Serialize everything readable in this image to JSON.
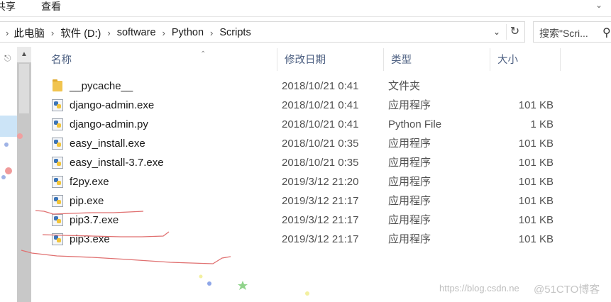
{
  "ribbon": {
    "tabs": [
      "共享",
      "查看"
    ],
    "expand_icon": "chevron-down-icon"
  },
  "address": {
    "crumbs": [
      "此电脑",
      "软件 (D:)",
      "software",
      "Python",
      "Scripts"
    ],
    "separator_icon": "chevron-right-icon",
    "search_placeholder": "搜索\"Scri..."
  },
  "columns": {
    "name": "名称",
    "date": "修改日期",
    "type": "类型",
    "size": "大小"
  },
  "files": [
    {
      "name": "__pycache__",
      "date": "2018/10/21 0:41",
      "type": "文件夹",
      "size": "",
      "icon": "folder-icon"
    },
    {
      "name": "django-admin.exe",
      "date": "2018/10/21 0:41",
      "type": "应用程序",
      "size": "101 KB",
      "icon": "python-file-icon"
    },
    {
      "name": "django-admin.py",
      "date": "2018/10/21 0:41",
      "type": "Python File",
      "size": "1 KB",
      "icon": "python-file-icon"
    },
    {
      "name": "easy_install.exe",
      "date": "2018/10/21 0:35",
      "type": "应用程序",
      "size": "101 KB",
      "icon": "python-file-icon"
    },
    {
      "name": "easy_install-3.7.exe",
      "date": "2018/10/21 0:35",
      "type": "应用程序",
      "size": "101 KB",
      "icon": "python-file-icon"
    },
    {
      "name": "f2py.exe",
      "date": "2019/3/12 21:20",
      "type": "应用程序",
      "size": "101 KB",
      "icon": "python-file-icon"
    },
    {
      "name": "pip.exe",
      "date": "2019/3/12 21:17",
      "type": "应用程序",
      "size": "101 KB",
      "icon": "python-file-icon"
    },
    {
      "name": "pip3.7.exe",
      "date": "2019/3/12 21:17",
      "type": "应用程序",
      "size": "101 KB",
      "icon": "python-file-icon"
    },
    {
      "name": "pip3.exe",
      "date": "2019/3/12 21:17",
      "type": "应用程序",
      "size": "101 KB",
      "icon": "python-file-icon"
    }
  ],
  "watermark": {
    "url": "https://blog.csdn.ne",
    "logo": "@51CTO博客"
  },
  "colors": {
    "header_text": "#4d6082",
    "doodle": "#e07070",
    "selection": "#cce4f7"
  }
}
